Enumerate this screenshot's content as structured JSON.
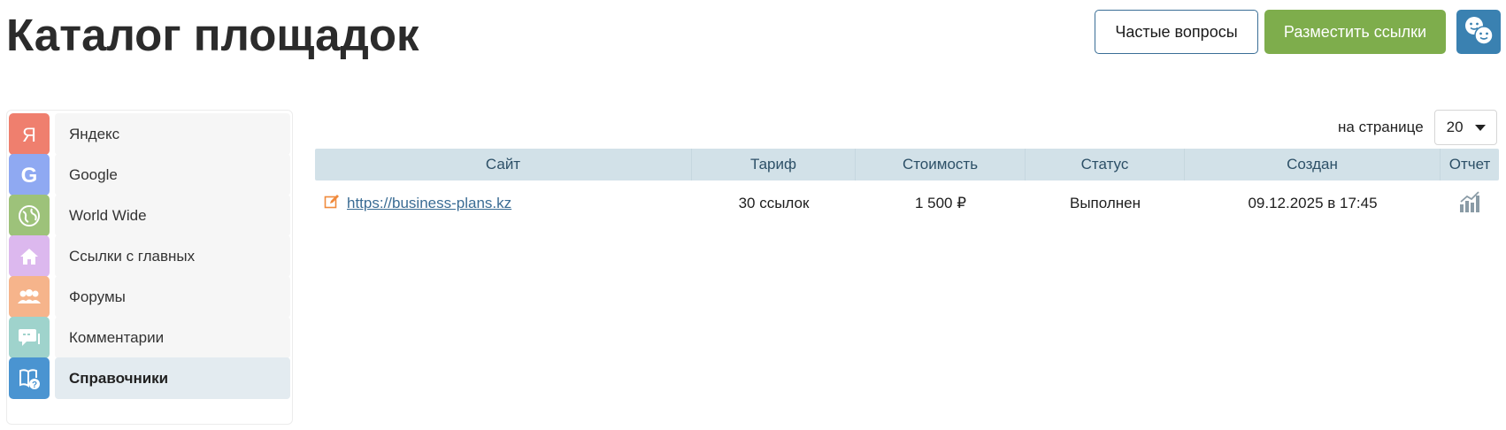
{
  "header": {
    "title": "Каталог площадок",
    "faq_label": "Частые вопросы",
    "place_links_label": "Разместить ссылки",
    "chat_icon": "chat-faces-icon"
  },
  "colors": {
    "accent_green": "#7ead4c",
    "accent_blue": "#3a81b1",
    "table_header_bg": "#d2e1e8",
    "link": "#3a6c94"
  },
  "sidebar": {
    "items": [
      {
        "label": "Яндекс",
        "icon": "yandex-icon",
        "color": "#ef7f6e",
        "active": false
      },
      {
        "label": "Google",
        "icon": "google-icon",
        "color": "#8fa9f2",
        "active": false
      },
      {
        "label": "World Wide",
        "icon": "globe-icon",
        "color": "#9dc27a",
        "active": false
      },
      {
        "label": "Ссылки с главных",
        "icon": "home-icon",
        "color": "#dcb8ee",
        "active": false
      },
      {
        "label": "Форумы",
        "icon": "users-icon",
        "color": "#f6b48b",
        "active": false
      },
      {
        "label": "Комментарии",
        "icon": "comments-icon",
        "color": "#9fd3cc",
        "active": false
      },
      {
        "label": "Справочники",
        "icon": "book-question-icon",
        "color": "#4a94d1",
        "active": true
      }
    ]
  },
  "pagination": {
    "per_page_label": "на странице",
    "per_page_value": "20"
  },
  "table": {
    "columns": [
      "Сайт",
      "Тариф",
      "Стоимость",
      "Статус",
      "Создан",
      "Отчет"
    ],
    "rows": [
      {
        "site": "https://business-plans.kz",
        "tariff": "30 ссылок",
        "cost": "1 500 ₽",
        "status": "Выполнен",
        "created": "09.12.2025 в 17:45",
        "edit_icon": "edit-icon",
        "report_icon": "bar-chart-icon"
      }
    ]
  }
}
